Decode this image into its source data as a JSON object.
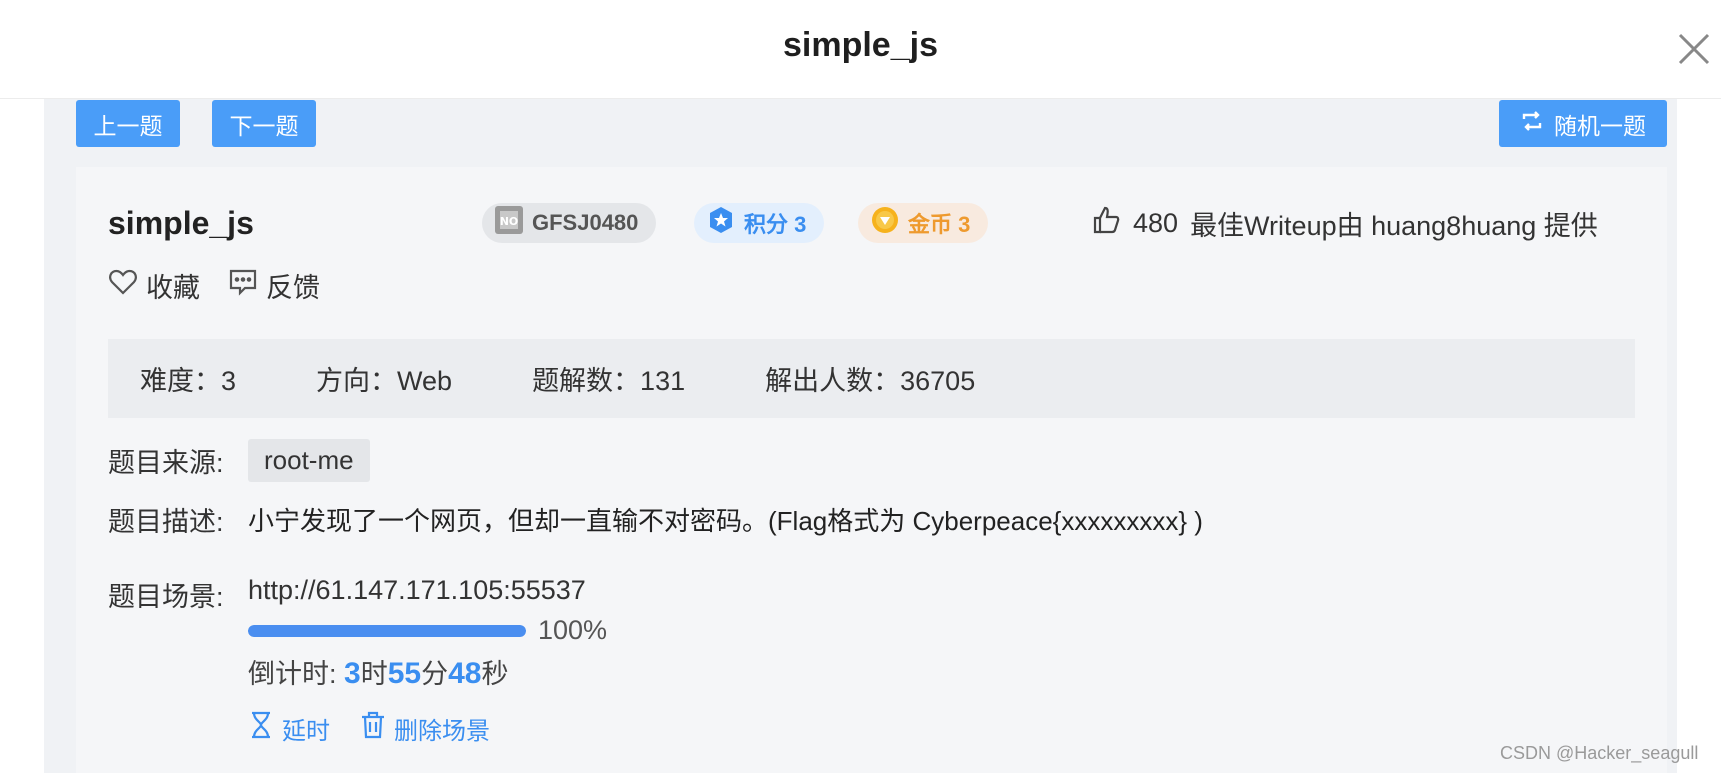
{
  "header": {
    "title": "simple_js"
  },
  "nav": {
    "prev_label": "上一题",
    "next_label": "下一题",
    "random_label": "随机一题"
  },
  "challenge": {
    "title": "simple_js",
    "id": "GFSJ0480",
    "score_label": "积分 3",
    "coin_label": "金币 3",
    "likes": "480",
    "writeup_credit": "最佳Writeup由 huang8huang 提供",
    "favorite_label": "收藏",
    "feedback_label": "反馈"
  },
  "stats": {
    "difficulty": "难度：3",
    "direction": "方向：Web",
    "solutions": "题解数：131",
    "solvers": "解出人数：36705"
  },
  "details": {
    "source_label": "题目来源:",
    "source_value": "root-me",
    "desc_label": "题目描述:",
    "desc_value": "小宁发现了一个网页，但却一直输不对密码。(Flag格式为 Cyberpeace{xxxxxxxxx} )",
    "scene_label": "题目场景:",
    "scene_url": "http://61.147.171.105:55537",
    "progress_percent": 100,
    "progress_text": "100%",
    "countdown_prefix": "倒计时: ",
    "hours": "3",
    "hours_unit": "时",
    "minutes": "55",
    "minutes_unit": "分",
    "seconds": "48",
    "seconds_unit": "秒",
    "extend_label": "延时",
    "delete_label": "删除场景"
  },
  "watermark": "CSDN @Hacker_seagull",
  "colors": {
    "primary": "#4a9df8",
    "link": "#3a8ef0",
    "coin": "#ee9a2e"
  }
}
